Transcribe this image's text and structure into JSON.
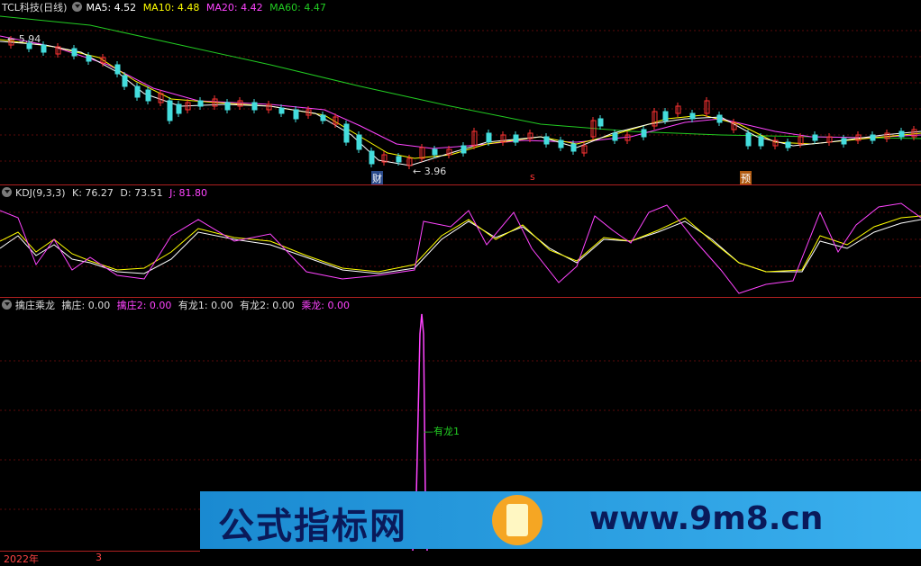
{
  "top_panel": {
    "title": "TCL科技(日线)",
    "ma5_label": "MA5: 4.52",
    "ma10_label": "MA10: 4.48",
    "ma20_label": "MA20: 4.42",
    "ma60_label": "MA60: 4.47",
    "high_marker": "5.94",
    "low_marker": "3.96",
    "tag_cai": "财",
    "tag_s": "s",
    "tag_yu": "预"
  },
  "kdj_panel": {
    "title": "KDJ(9,3,3)",
    "k_label": "K: 76.27",
    "d_label": "D: 73.51",
    "j_label": "J: 81.80"
  },
  "indicator_panel": {
    "title": "擒庄乘龙",
    "qz_label": "擒庄: 0.00",
    "qz2_label": "擒庄2: 0.00",
    "yl1_label": "有龙1: 0.00",
    "yl2_label": "有龙2: 0.00",
    "cl_label": "乘龙: 0.00",
    "spike_label": "有龙1"
  },
  "axis": {
    "year_label": "2022年",
    "month_label": "3"
  },
  "watermark": {
    "left_text": "公式指标网",
    "right_text": "www.9m8.cn"
  },
  "colors": {
    "ma5": "#ffffff",
    "ma10": "#ffff00",
    "ma20": "#ff44ff",
    "ma60": "#22cc22",
    "up": "#ff3333",
    "down": "#44dddd",
    "grid": "#5a0a0a"
  }
}
